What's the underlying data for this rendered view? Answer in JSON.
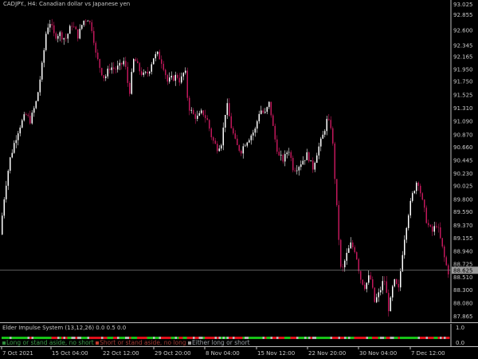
{
  "chart_title": "CADJPY., H4:  Canadian dollar vs Japanese yen",
  "indicator": {
    "title": "Elder Impulse System (13,12,26) 0.0 0.5 0.0",
    "scale_top": "1.0",
    "scale_bottom": "0.0",
    "legend": [
      {
        "label": "Long or stand aside, no short",
        "color": "#2e8b3c"
      },
      {
        "label": "Short or stand aside, no long",
        "color": "#c0392b"
      },
      {
        "label": "Either long or short",
        "color": "#9e9e9e"
      }
    ],
    "colors": {
      "up": "#17c217",
      "down": "#e0101a",
      "neutral": "#b4b4b4"
    }
  },
  "price_axis": [
    "93.025",
    "92.855",
    "92.600",
    "92.345",
    "92.165",
    "91.950",
    "91.750",
    "91.525",
    "91.310",
    "91.090",
    "90.870",
    "90.660",
    "90.445",
    "90.230",
    "90.025",
    "89.800",
    "89.590",
    "89.370",
    "89.155",
    "88.940",
    "88.725",
    "88.510",
    "88.300",
    "88.080",
    "87.865"
  ],
  "current_price": "88.625",
  "time_axis": [
    "7 Oct 2021",
    "15 Oct 04:00",
    "22 Oct 12:00",
    "29 Oct 20:00",
    "8 Nov 04:00",
    "15 Nov 12:00",
    "22 Nov 20:00",
    "30 Nov 04:00",
    "7 Dec 12:00"
  ],
  "colors": {
    "background": "#000000",
    "bull_candle": "#ffffff",
    "bear_candle": "#c2185b",
    "axis_text": "#c8c8c8",
    "current_line": "#808080"
  },
  "chart_data": {
    "type": "candlestick",
    "symbol": "CADJPY.",
    "timeframe": "H4",
    "ylim": [
      87.75,
      93.1
    ],
    "path": [
      [
        0,
        88.95
      ],
      [
        3,
        89.35
      ],
      [
        8,
        89.95
      ],
      [
        14,
        90.45
      ],
      [
        20,
        90.75
      ],
      [
        26,
        91.0
      ],
      [
        34,
        91.2
      ],
      [
        40,
        91.1
      ],
      [
        48,
        91.45
      ],
      [
        55,
        92.05
      ],
      [
        60,
        92.6
      ],
      [
        64,
        92.75
      ],
      [
        70,
        92.5
      ],
      [
        76,
        92.55
      ],
      [
        84,
        92.45
      ],
      [
        92,
        92.7
      ],
      [
        100,
        92.5
      ],
      [
        106,
        92.75
      ],
      [
        112,
        92.8
      ],
      [
        118,
        92.6
      ],
      [
        122,
        92.2
      ],
      [
        128,
        91.95
      ],
      [
        133,
        91.8
      ],
      [
        140,
        92.0
      ],
      [
        146,
        91.95
      ],
      [
        152,
        92.0
      ],
      [
        158,
        92.1
      ],
      [
        164,
        91.55
      ],
      [
        170,
        92.15
      ],
      [
        176,
        91.95
      ],
      [
        182,
        91.85
      ],
      [
        188,
        91.9
      ],
      [
        194,
        92.15
      ],
      [
        200,
        92.2
      ],
      [
        206,
        92.05
      ],
      [
        212,
        91.75
      ],
      [
        218,
        91.8
      ],
      [
        224,
        91.85
      ],
      [
        228,
        91.75
      ],
      [
        234,
        91.95
      ],
      [
        238,
        91.35
      ],
      [
        244,
        91.2
      ],
      [
        250,
        91.15
      ],
      [
        256,
        91.25
      ],
      [
        262,
        91.1
      ],
      [
        268,
        90.8
      ],
      [
        274,
        90.65
      ],
      [
        280,
        90.75
      ],
      [
        286,
        91.4
      ],
      [
        292,
        91.0
      ],
      [
        298,
        90.7
      ],
      [
        304,
        90.6
      ],
      [
        310,
        90.75
      ],
      [
        316,
        90.85
      ],
      [
        322,
        90.95
      ],
      [
        328,
        91.3
      ],
      [
        334,
        91.2
      ],
      [
        340,
        91.4
      ],
      [
        346,
        90.85
      ],
      [
        352,
        90.5
      ],
      [
        358,
        90.45
      ],
      [
        364,
        90.65
      ],
      [
        370,
        90.3
      ],
      [
        376,
        90.35
      ],
      [
        382,
        90.45
      ],
      [
        388,
        90.55
      ],
      [
        394,
        90.3
      ],
      [
        400,
        90.6
      ],
      [
        406,
        90.8
      ],
      [
        412,
        91.1
      ],
      [
        418,
        91.0
      ],
      [
        424,
        89.75
      ],
      [
        430,
        88.55
      ],
      [
        436,
        88.85
      ],
      [
        442,
        89.05
      ],
      [
        448,
        88.95
      ],
      [
        454,
        88.5
      ],
      [
        460,
        88.35
      ],
      [
        466,
        88.55
      ],
      [
        472,
        88.1
      ],
      [
        478,
        88.25
      ],
      [
        484,
        88.5
      ],
      [
        490,
        87.95
      ],
      [
        496,
        88.45
      ],
      [
        502,
        88.3
      ],
      [
        508,
        89.05
      ],
      [
        514,
        89.55
      ],
      [
        520,
        89.9
      ],
      [
        526,
        90.15
      ],
      [
        532,
        89.75
      ],
      [
        538,
        89.4
      ],
      [
        544,
        89.25
      ],
      [
        550,
        89.4
      ],
      [
        556,
        89.05
      ],
      [
        560,
        88.8
      ],
      [
        564,
        88.6
      ]
    ],
    "current_price": 88.625
  }
}
